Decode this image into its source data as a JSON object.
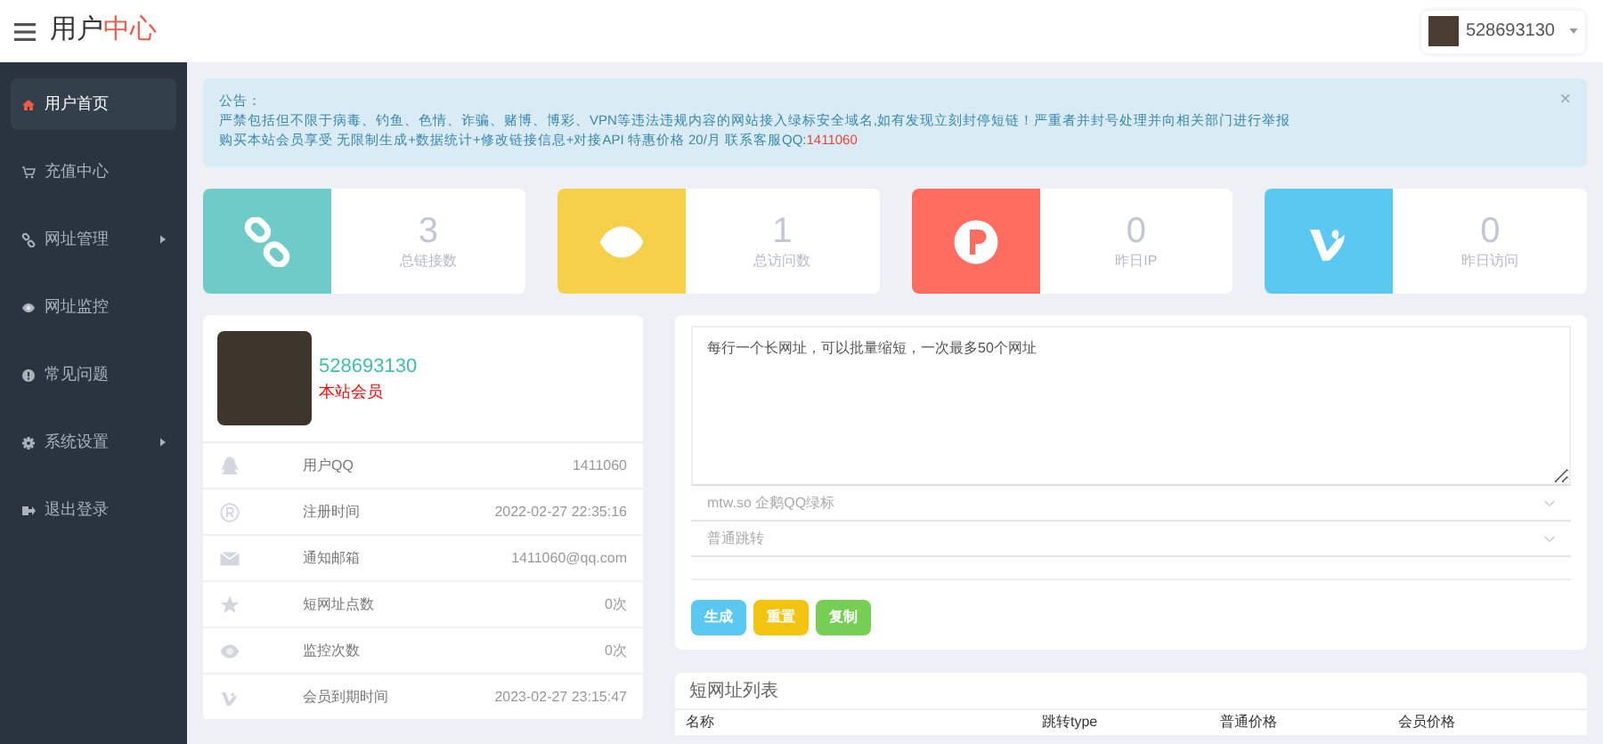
{
  "header": {
    "title": "用户",
    "title_accent": "中心",
    "user": "528693130"
  },
  "sidebar": {
    "items": [
      {
        "label": "用户首页",
        "selected": true,
        "submenu": false
      },
      {
        "label": "充值中心",
        "selected": false,
        "submenu": false
      },
      {
        "label": "网址管理",
        "selected": false,
        "submenu": true
      },
      {
        "label": "网址监控",
        "selected": false,
        "submenu": false
      },
      {
        "label": "常见问题",
        "selected": false,
        "submenu": false
      },
      {
        "label": "系统设置",
        "selected": false,
        "submenu": true
      },
      {
        "label": "退出登录",
        "selected": false,
        "submenu": false
      }
    ]
  },
  "notice": {
    "title": "公告：",
    "line_1": "严禁包括但不限于病毒、钓鱼、色情、诈骗、赌博、博彩、VPN等违法违规内容的网站接入绿标安全域名,如有发现立刻封停短链！严重者并封号处理并向相关部门进行举报",
    "line_2": "购买本站会员享受 无限制生成+数据统计+修改链接信息+对接API 特惠价格 20/月 联系客服QQ:",
    "qq": "1411060",
    "close": "×"
  },
  "stats": [
    {
      "color": "#6ecbc8",
      "value": "3",
      "label": "总链接数"
    },
    {
      "color": "#f7d04b",
      "value": "1",
      "label": "总访问数"
    },
    {
      "color": "#fe6c5f",
      "value": "0",
      "label": "昨日IP"
    },
    {
      "color": "#5bc8f2",
      "value": "0",
      "label": "昨日访问"
    }
  ],
  "profile": {
    "name": "528693130",
    "role": "本站会员",
    "rows": [
      {
        "label": "用户QQ",
        "value": "1411060"
      },
      {
        "label": "注册时间",
        "value": "2022-02-27 22:35:16"
      },
      {
        "label": "通知邮箱",
        "value": "1411060@qq.com"
      },
      {
        "label": "短网址点数",
        "value": "0次"
      },
      {
        "label": "监控次数",
        "value": "0次"
      },
      {
        "label": "会员到期时间",
        "value": "2023-02-27 23:15:47"
      }
    ]
  },
  "shortener": {
    "placeholder": "每行一个长网址，可以批量缩短，一次最多50个网址",
    "domain": "mtw.so 企鹅QQ绿标",
    "mode": "普通跳转",
    "buttons": [
      {
        "label": "生成",
        "color": "#5bc8f2"
      },
      {
        "label": "重置",
        "color": "#f2c40f"
      },
      {
        "label": "复制",
        "color": "#76cf52"
      }
    ]
  },
  "list": {
    "title": "短网址列表",
    "columns": [
      "名称",
      "跳转type",
      "普通价格",
      "会员价格"
    ]
  }
}
